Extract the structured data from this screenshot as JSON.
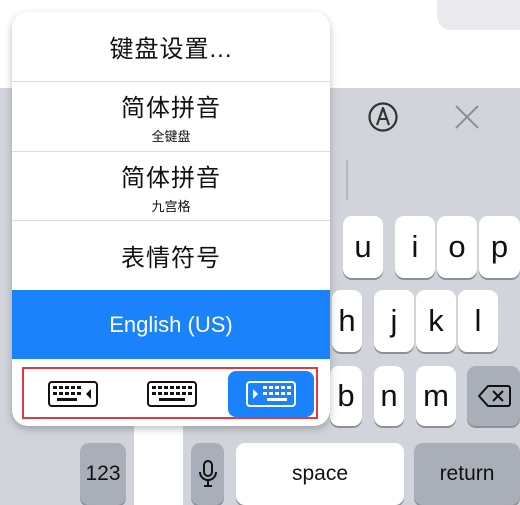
{
  "popup": {
    "items": [
      {
        "label": "键盘设置...",
        "sub": ""
      },
      {
        "label": "简体拼音",
        "sub": "全键盘"
      },
      {
        "label": "简体拼音",
        "sub": "九宫格"
      },
      {
        "label": "表情符号",
        "sub": ""
      },
      {
        "label": "English (US)",
        "sub": ""
      }
    ],
    "selected_index": 4,
    "layout_options": [
      "left-handed-keyboard-icon",
      "full-keyboard-icon",
      "right-handed-keyboard-icon"
    ],
    "active_layout": "right-handed-keyboard-icon"
  },
  "toolbar": {
    "icons": [
      "handwriting-icon",
      "close-icon"
    ]
  },
  "keyboard": {
    "row1": [
      "u",
      "i",
      "o",
      "p"
    ],
    "row2": [
      "h",
      "j",
      "k",
      "l"
    ],
    "row3": [
      "b",
      "n",
      "m"
    ],
    "numbers_label": "123",
    "space_label": "space",
    "return_label": "return"
  },
  "colors": {
    "accent": "#1a82fb",
    "keyboard_bg": "#d1d4da",
    "key_bg": "#ffffff",
    "dark_key_bg": "#a9afb8",
    "highlight": "#e0393e"
  }
}
